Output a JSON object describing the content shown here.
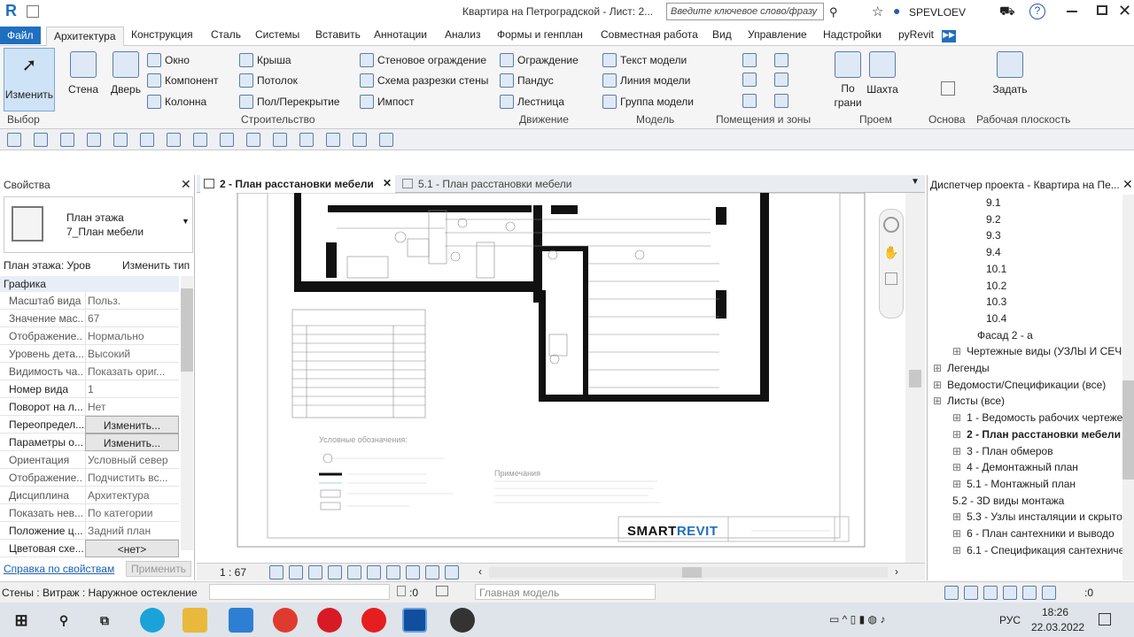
{
  "title_bar": {
    "app_letter": "R",
    "doc_title": "Квартира на Петроградской - Лист: 2...",
    "search_placeholder": "Введите ключевое слово/фразу",
    "user": "SPEVLOEV"
  },
  "ribbon_tabs": [
    "Файл",
    "Архитектура",
    "Конструкция",
    "Сталь",
    "Системы",
    "Вставить",
    "Аннотации",
    "Анализ",
    "Формы и генплан",
    "Совместная работа",
    "Вид",
    "Управление",
    "Надстройки",
    "pyRevit"
  ],
  "ribbon": {
    "modify": "Изменить",
    "select": "Выбор",
    "wall": "Стена",
    "door": "Дверь",
    "window": "Окно",
    "component": "Компонент",
    "column": "Колонна",
    "roof": "Крыша",
    "ceiling": "Потолок",
    "floor": "Пол/Перекрытие",
    "curtain_system": "Стеновое ограждение",
    "curtain_grid": "Схема разрезки стены",
    "mullion": "Импост",
    "railing": "Ограждение",
    "ramp": "Пандус",
    "stair": "Лестница",
    "model_text": "Текст модели",
    "model_line": "Линия модели",
    "model_group": "Группа модели",
    "by_face": "По грани",
    "shaft": "Шахта",
    "set": "Задать",
    "panels": {
      "build": "Строительство",
      "circulation": "Движение",
      "model": "Модель",
      "room": "Помещения и зоны",
      "opening": "Проем",
      "datum": "Основа",
      "workplane": "Рабочая плоскость"
    }
  },
  "properties": {
    "header": "Свойства",
    "type_line1": "План этажа",
    "type_line2": "7_План мебели",
    "filter": "План этажа: Уров",
    "edit_type": "Изменить тип",
    "section": "Графика",
    "rows": [
      {
        "k": "Масштаб вида",
        "v": "Польз."
      },
      {
        "k": "Значение мас...",
        "v": "67"
      },
      {
        "k": "Отображение...",
        "v": "Нормально"
      },
      {
        "k": "Уровень дета...",
        "v": "Высокий"
      },
      {
        "k": "Видимость ча...",
        "v": "Показать ориг..."
      },
      {
        "k": "Номер вида",
        "v": "1"
      },
      {
        "k": "Поворот на л...",
        "v": "Нет"
      },
      {
        "k": "Переопредел...",
        "v": "Изменить..."
      },
      {
        "k": "Параметры о...",
        "v": "Изменить..."
      },
      {
        "k": "Ориентация",
        "v": "Условный север"
      },
      {
        "k": "Отображение...",
        "v": "Подчистить вс..."
      },
      {
        "k": "Дисциплина",
        "v": "Архитектура"
      },
      {
        "k": "Показать нев...",
        "v": "По категории"
      },
      {
        "k": "Положение ц...",
        "v": "Задний план"
      },
      {
        "k": "Цветовая схе...",
        "v": "<нет>"
      }
    ],
    "help": "Справка по свойствам",
    "apply": "Применить"
  },
  "view_tabs": [
    "2 - План расстановки мебели",
    "5.1 - План расстановки мебели"
  ],
  "sheet": {
    "logo_a": "SMART",
    "logo_b": "REVIT",
    "legend": "Условные обозначения:",
    "notes": "Примечания"
  },
  "view_nav": {
    "scale": "1 : 67"
  },
  "browser": {
    "header": "Диспетчер проекта - Квартира на Пе...",
    "items": [
      "9.1",
      "9.2",
      "9.3",
      "9.4",
      "10.1",
      "10.2",
      "10.3",
      "10.4",
      "Фасад 2 - а",
      "Чертежные виды (УЗЛЫ И СЕЧЕ",
      "Легенды",
      "Ведомости/Спецификации (все)",
      "Листы (все)",
      "1 - Ведомость рабочих чертеже",
      "2 - План расстановки мебели",
      "3 - План обмеров",
      "4 - Демонтажный план",
      "5.1 - Монтажный план",
      "5.2 - 3D виды монтажа",
      "5.3 - Узлы инсталяции и скрыто",
      "6 - План сантехники и выводо",
      "6.1 - Спецификация сантехниче"
    ]
  },
  "status": {
    "text": "Стены : Витраж : Наружное остекление",
    "count": ":0",
    "model": "Главная модель",
    "right_count": ":0"
  },
  "taskbar": {
    "lang": "РУС",
    "time": "18:26",
    "date": "22.03.2022"
  }
}
